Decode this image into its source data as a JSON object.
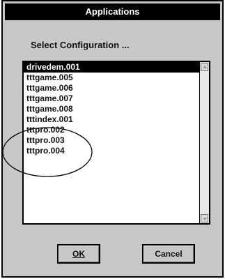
{
  "window": {
    "title": "Applications"
  },
  "dialog": {
    "prompt": "Select Configuration ...",
    "list": {
      "items": [
        "drivedem.001",
        "tttgame.005",
        "tttgame.006",
        "tttgame.007",
        "tttgame.008",
        "tttindex.001",
        "tttpro.002",
        "tttpro.003",
        "tttpro.004"
      ],
      "selected": "drivedem.001"
    },
    "buttons": {
      "ok_label": "OK",
      "cancel_label": "Cancel"
    }
  },
  "colors": {
    "titlebar": "#000000",
    "dialog_bg": "#c8c8c8",
    "selection": "#000000"
  }
}
